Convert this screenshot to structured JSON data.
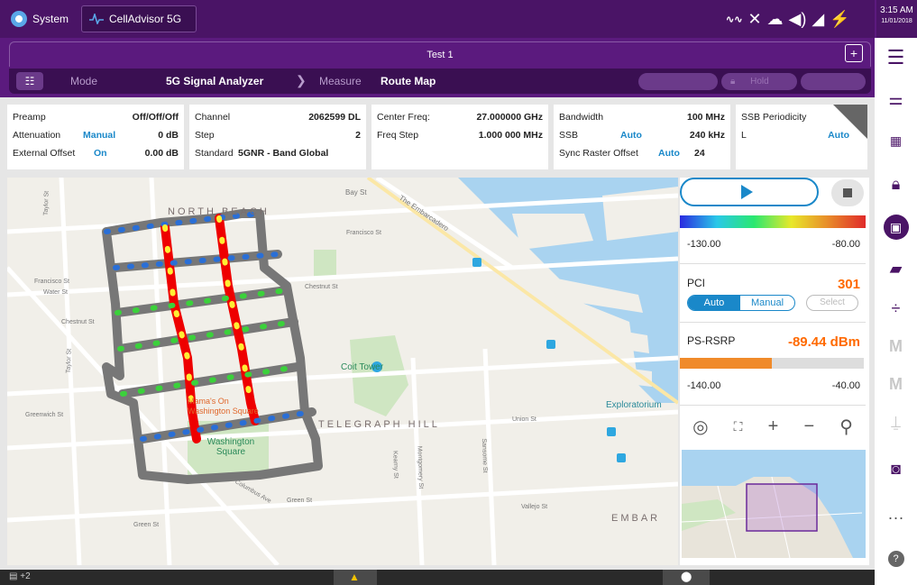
{
  "window": {
    "tab_system": "System",
    "tab_app": "CellAdvisor 5G"
  },
  "clock": {
    "time": "3:15 AM",
    "date": "11/01/2018"
  },
  "test_bar": {
    "title": "Test 1",
    "plus": "+"
  },
  "mode_bar": {
    "mode_label": "Mode",
    "mode_value": "5G Signal Analyzer",
    "measure_label": "Measure",
    "measure_value": "Route Map",
    "hold_label": "Hold"
  },
  "params": {
    "preamp_label": "Preamp",
    "preamp_value": "Off/Off/Off",
    "attenuation_label": "Attenuation",
    "attenuation_mode": "Manual",
    "attenuation_value": "0 dB",
    "ext_offset_label": "External Offset",
    "ext_offset_mode": "On",
    "ext_offset_value": "0.00 dB",
    "channel_label": "Channel",
    "channel_value": "2062599 DL",
    "step_label": "Step",
    "step_value": "2",
    "standard_label": "Standard",
    "standard_value": "5GNR - Band Global",
    "center_freq_label": "Center Freq:",
    "center_freq_value": "27.000000 GHz",
    "freq_step_label": "Freq Step",
    "freq_step_value": "1.000 000 MHz",
    "bandwidth_label": "Bandwidth",
    "bandwidth_value": "100 MHz",
    "ssb_label": "SSB",
    "ssb_mode": "Auto",
    "ssb_value": "240 kHz",
    "sync_raster_label": "Sync Raster Offset",
    "sync_raster_mode": "Auto",
    "sync_raster_value": "24",
    "ssb_period_label": "SSB Periodicity",
    "l_label": "L",
    "l_mode": "Auto"
  },
  "map": {
    "labels": {
      "north_beach": "NORTH BEACH",
      "coit": "Coit Tower",
      "telegraph": "TELEGRAPH HILL",
      "washington": "Washington Square",
      "mamas": "Mama's On Washington Square",
      "exploratorium": "Exploratorium",
      "embar": "EMBAR",
      "bay_st": "Bay St",
      "embarcadero": "The Embarcadero",
      "francisco_st": "Francisco St",
      "chestnut_st": "Chestnut St",
      "water_st": "Water St",
      "greenwich": "Greenwich St",
      "union_st": "Union St",
      "green_st": "Green St",
      "vallejo_st": "Vallejo St",
      "columbus": "Columbus Ave",
      "taylor_st": "Taylor St",
      "kearny": "Kearny St",
      "sansome": "Sansome St",
      "montgomery": "Montgomery St"
    }
  },
  "right_panel": {
    "scale_min": "-130.00",
    "scale_max": "-80.00",
    "pci_label": "PCI",
    "pci_value": "301",
    "pci_auto": "Auto",
    "pci_manual": "Manual",
    "pci_select": "Select",
    "rsrp_label": "PS-RSRP",
    "rsrp_value": "-89.44 dBm",
    "rsrp_min": "-140.00",
    "rsrp_max": "-40.00",
    "rsrp_fill": 0.5,
    "zoom_in": "+",
    "zoom_out": "−"
  },
  "bottom": {
    "badge": "+2"
  },
  "colors": {
    "purple": "#4a1466",
    "accent_orange": "#ff6a00",
    "blue": "#1a88c9"
  }
}
